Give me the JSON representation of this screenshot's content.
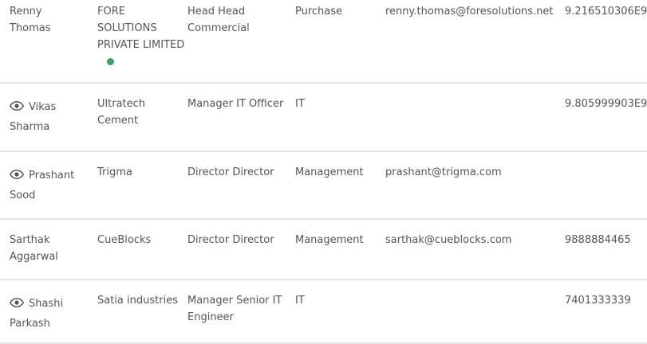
{
  "rows": [
    {
      "first": "Renny",
      "last": "Thomas",
      "viewable": false,
      "company": "FORE SOLUTIONS PRIVATE LIMITED",
      "online": true,
      "designation": "Head Head Commercial",
      "department": "Purchase",
      "email": "renny.thomas@foresolutions.net",
      "phone": "9.216510306E9"
    },
    {
      "first": "Vikas",
      "last": "Sharma",
      "viewable": true,
      "company": "Ultratech Cement",
      "online": false,
      "designation": "Manager IT Officer",
      "department": "IT",
      "email": "",
      "phone": "9.805999903E9"
    },
    {
      "first": "Prashant",
      "last": "Sood",
      "viewable": true,
      "company": "Trigma",
      "online": false,
      "designation": "Director Director",
      "department": "Management",
      "email": "prashant@trigma.com",
      "phone": ""
    },
    {
      "first": "Sarthak",
      "last": "Aggarwal",
      "viewable": false,
      "company": "CueBlocks",
      "online": false,
      "designation": "Director Director",
      "department": "Management",
      "email": "sarthak@cueblocks.com",
      "phone": "9888884465"
    },
    {
      "first": "Shashi",
      "last": "Parkash",
      "viewable": true,
      "company": "Satia industries",
      "online": false,
      "designation": "Manager Senior IT Engineer",
      "department": "IT",
      "email": "",
      "phone": "7401333339"
    }
  ],
  "colors": {
    "text": "#555555",
    "divider": "#e3e3e3",
    "online": "#3aa36b"
  }
}
